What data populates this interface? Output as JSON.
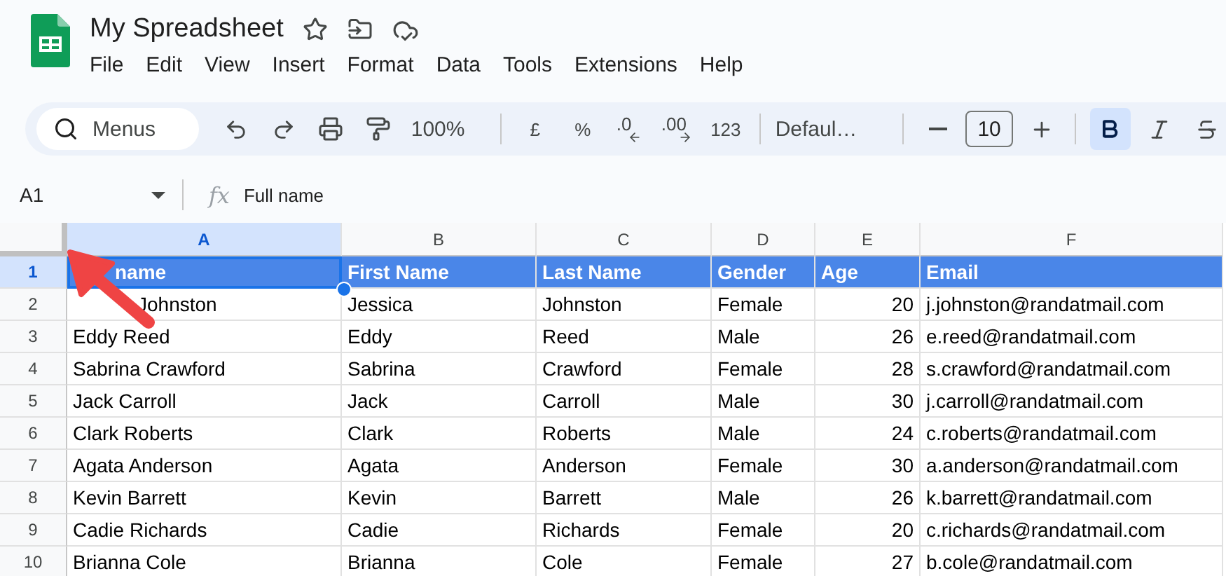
{
  "document": {
    "title": "My Spreadsheet"
  },
  "menu": [
    "File",
    "Edit",
    "View",
    "Insert",
    "Format",
    "Data",
    "Tools",
    "Extensions",
    "Help"
  ],
  "toolbar": {
    "search": {
      "placeholder": "Menus"
    },
    "zoom": "100%",
    "currency": "£",
    "percent": "%",
    "decrease_decimal": ".0",
    "increase_decimal": ".00",
    "number_format": "123",
    "font": "Defaul…",
    "font_size": "10",
    "bold": {
      "selected": true
    }
  },
  "formula_bar": {
    "cell_ref": "A1",
    "fx": "fx",
    "value": "Full name"
  },
  "columns": [
    {
      "letter": "A",
      "selected": true
    },
    {
      "letter": "B",
      "selected": false
    },
    {
      "letter": "C",
      "selected": false
    },
    {
      "letter": "D",
      "selected": false
    },
    {
      "letter": "E",
      "selected": false
    },
    {
      "letter": "F",
      "selected": false
    }
  ],
  "rows": [
    {
      "number": "1",
      "selected": true,
      "kind": "header",
      "lead_hidden": true,
      "cells": [
        "name",
        "First Name",
        "Last Name",
        "Gender",
        "Age",
        "Email"
      ]
    },
    {
      "number": "2",
      "selected": false,
      "kind": "data",
      "lead_hidden": true,
      "cells": [
        "Johnston",
        "Jessica",
        "Johnston",
        "Female",
        "20",
        "j.johnston@randatmail.com"
      ]
    },
    {
      "number": "3",
      "selected": false,
      "kind": "data",
      "cells": [
        "Eddy Reed",
        "Eddy",
        "Reed",
        "Male",
        "26",
        "e.reed@randatmail.com"
      ]
    },
    {
      "number": "4",
      "selected": false,
      "kind": "data",
      "cells": [
        "Sabrina Crawford",
        "Sabrina",
        "Crawford",
        "Female",
        "28",
        "s.crawford@randatmail.com"
      ]
    },
    {
      "number": "5",
      "selected": false,
      "kind": "data",
      "cells": [
        "Jack Carroll",
        "Jack",
        "Carroll",
        "Male",
        "30",
        "j.carroll@randatmail.com"
      ]
    },
    {
      "number": "6",
      "selected": false,
      "kind": "data",
      "cells": [
        "Clark Roberts",
        "Clark",
        "Roberts",
        "Male",
        "24",
        "c.roberts@randatmail.com"
      ]
    },
    {
      "number": "7",
      "selected": false,
      "kind": "data",
      "cells": [
        "Agata Anderson",
        "Agata",
        "Anderson",
        "Female",
        "30",
        "a.anderson@randatmail.com"
      ]
    },
    {
      "number": "8",
      "selected": false,
      "kind": "data",
      "cells": [
        "Kevin Barrett",
        "Kevin",
        "Barrett",
        "Male",
        "26",
        "k.barrett@randatmail.com"
      ]
    },
    {
      "number": "9",
      "selected": false,
      "kind": "data",
      "cells": [
        "Cadie Richards",
        "Cadie",
        "Richards",
        "Female",
        "20",
        "c.richards@randatmail.com"
      ]
    },
    {
      "number": "10",
      "selected": false,
      "kind": "data",
      "cells": [
        "Brianna Cole",
        "Brianna",
        "Cole",
        "Female",
        "27",
        "b.cole@randatmail.com"
      ]
    }
  ]
}
